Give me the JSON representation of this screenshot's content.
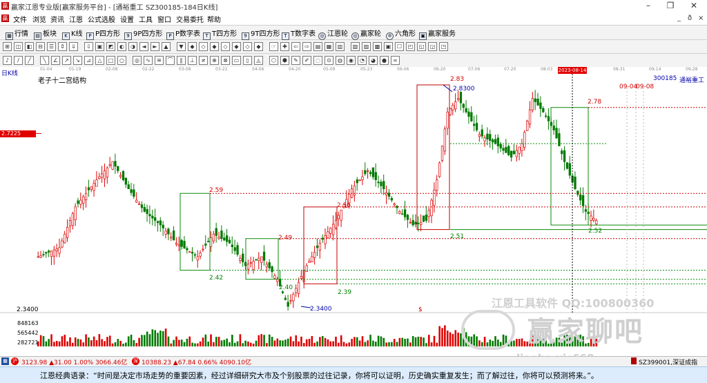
{
  "window": {
    "title": "赢家江恩专业版[赢家服务平台] - [通裕重工   SZ300185-184日K线]",
    "logo": "赢",
    "min": "–",
    "max": "❐",
    "close": "✕"
  },
  "menu": {
    "items": [
      "文件",
      "浏览",
      "资讯",
      "江恩",
      "公式选股",
      "设置",
      "工具",
      "窗口",
      "交易委托",
      "帮助"
    ],
    "mdi": [
      "_",
      "ð",
      "×"
    ]
  },
  "toolbar1": {
    "items": [
      {
        "icon": "▦",
        "label": "行情"
      },
      {
        "icon": "▤",
        "label": "板块"
      },
      {
        "icon": "K",
        "label": "K线"
      },
      {
        "icon": "P",
        "label": "P四方形"
      },
      {
        "icon": "9",
        "label": "9P四方形"
      },
      {
        "icon": "P",
        "label": "P数字表"
      },
      {
        "icon": "T",
        "label": "T四方形"
      },
      {
        "icon": "9",
        "label": "9T四方形"
      },
      {
        "icon": "T",
        "label": "T数字表"
      },
      {
        "icon": "◎",
        "label": "江恩轮"
      },
      {
        "icon": "◎",
        "label": "赢家轮"
      },
      {
        "icon": "✡",
        "label": "六角形"
      },
      {
        "icon": "▣",
        "label": "赢家服务"
      }
    ]
  },
  "chart": {
    "period_label": "日K线",
    "study_title": "老子十二宫结构",
    "stock_code": "300185",
    "stock_name": "通裕重工",
    "dates": [
      "01-04",
      "01-19",
      "02-08",
      "02-22",
      "03-08",
      "03-22",
      "04-06",
      "04-20",
      "05-09",
      "05-23",
      "06-06",
      "06-20",
      "07-06",
      "07-20",
      "08-03",
      "2023-08-14",
      "08-31",
      "09-14",
      "09-28"
    ],
    "cursor_date": "2023-08-14",
    "cursor_price": "2.7225",
    "ymin_label": "2.3400",
    "vol_labels": [
      "848163",
      "565442",
      "282721"
    ],
    "annotations": {
      "p259": "2.59",
      "p242": "2.42",
      "p249": "2.49",
      "p240": "2.40",
      "p2340": "2.3400",
      "p239": "2.39",
      "p256": "2.56",
      "p283": "2.83",
      "p28300": "2.8300",
      "p251": "2.51",
      "p278": "2.78",
      "p252": "2.52",
      "f1": "09-04",
      "f2": "09-08",
      "dollar": "$"
    }
  },
  "watermark": {
    "line1": "江恩工具软件  QQ:100800360",
    "line2": "赢家聊吧",
    "line3": "liaoba.yjc668"
  },
  "status": {
    "idx1": "3123.98 ▲31.00 1.00% 3066.46亿",
    "idx2": "10388.23 ▲67.84 0.66% 4090.10亿",
    "right": "SZ399001,深证成指"
  },
  "quote": {
    "text": "江恩经典语录：“时间是决定市场走势的重要因素，经过详细研究大市及个别股票的过往记录，你将可以证明，历史确实重复发生；而了解过往，你将可以预测将来。”。"
  },
  "colors": {
    "up": "#dd0000",
    "down": "#007a00",
    "accent": "#0000aa"
  }
}
